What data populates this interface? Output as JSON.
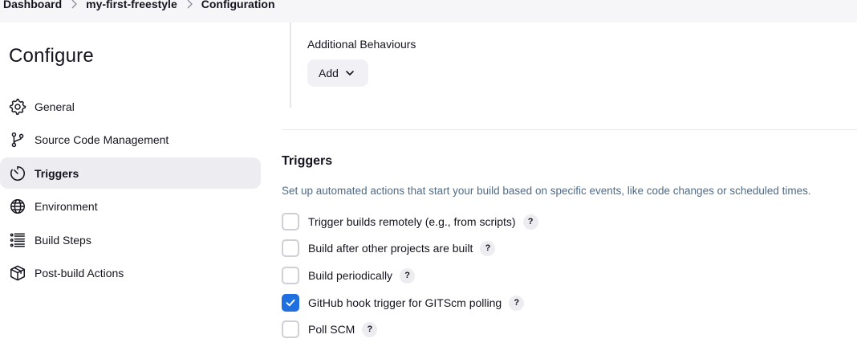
{
  "breadcrumb": {
    "items": [
      "Dashboard",
      "my-first-freestyle",
      "Configuration"
    ]
  },
  "page": {
    "title": "Configure"
  },
  "sidebar": {
    "items": [
      {
        "label": "General",
        "icon": "gear-icon",
        "active": false
      },
      {
        "label": "Source Code Management",
        "icon": "git-branch-icon",
        "active": false
      },
      {
        "label": "Triggers",
        "icon": "timer-icon",
        "active": true
      },
      {
        "label": "Environment",
        "icon": "globe-icon",
        "active": false
      },
      {
        "label": "Build Steps",
        "icon": "list-icon",
        "active": false
      },
      {
        "label": "Post-build Actions",
        "icon": "package-icon",
        "active": false
      }
    ]
  },
  "scm": {
    "additional_behaviours_label": "Additional Behaviours",
    "add_button_label": "Add"
  },
  "triggers": {
    "title": "Triggers",
    "description": "Set up automated actions that start your build based on specific events, like code changes or scheduled times.",
    "options": [
      {
        "label": "Trigger builds remotely (e.g., from scripts)",
        "checked": false
      },
      {
        "label": "Build after other projects are built",
        "checked": false
      },
      {
        "label": "Build periodically",
        "checked": false
      },
      {
        "label": "GitHub hook trigger for GITScm polling",
        "checked": true
      },
      {
        "label": "Poll SCM",
        "checked": false
      }
    ],
    "help_label": "?"
  },
  "colors": {
    "accent": "#1f6fe0",
    "sidebar_active_bg": "#ececf1",
    "description_text": "#4d6b8a"
  }
}
